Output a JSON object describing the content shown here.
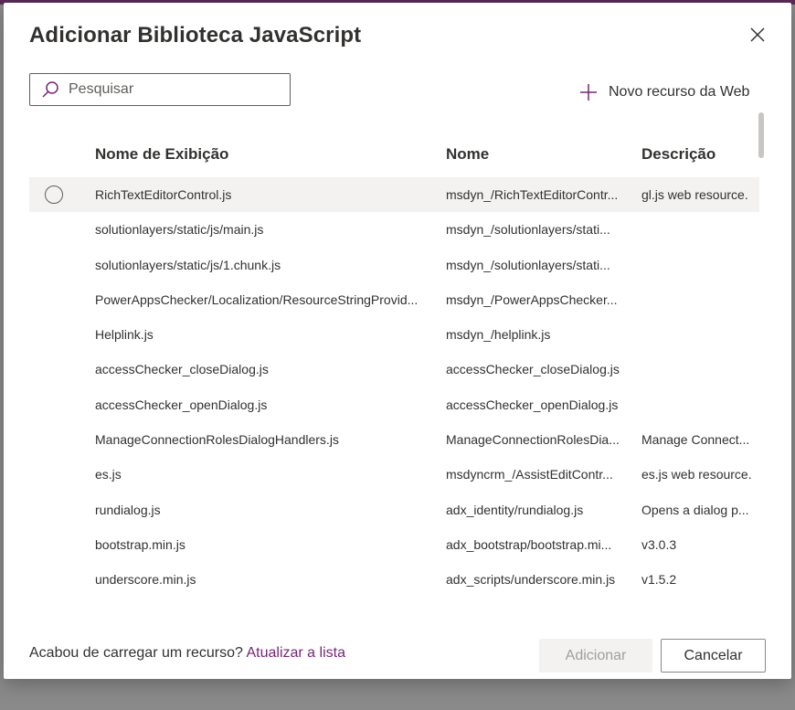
{
  "dialog": {
    "title": "Adicionar Biblioteca JavaScript",
    "close_icon": "close-icon"
  },
  "search": {
    "placeholder": "Pesquisar",
    "value": "",
    "icon": "search-icon"
  },
  "toolbar": {
    "new_resource_label": "Novo recurso da Web",
    "new_resource_icon": "plus-icon"
  },
  "table": {
    "headers": [
      "Nome de Exibição",
      "Nome",
      "Descrição"
    ],
    "rows": [
      {
        "display": "RichTextEditorControl.js",
        "name": "msdyn_/RichTextEditorContr...",
        "desc": "gl.js web resource."
      },
      {
        "display": "solutionlayers/static/js/main.js",
        "name": "msdyn_/solutionlayers/stati...",
        "desc": ""
      },
      {
        "display": "solutionlayers/static/js/1.chunk.js",
        "name": "msdyn_/solutionlayers/stati...",
        "desc": ""
      },
      {
        "display": "PowerAppsChecker/Localization/ResourceStringProvid...",
        "name": "msdyn_/PowerAppsChecker...",
        "desc": ""
      },
      {
        "display": "Helplink.js",
        "name": "msdyn_/helplink.js",
        "desc": ""
      },
      {
        "display": "accessChecker_closeDialog.js",
        "name": "accessChecker_closeDialog.js",
        "desc": ""
      },
      {
        "display": "accessChecker_openDialog.js",
        "name": "accessChecker_openDialog.js",
        "desc": ""
      },
      {
        "display": "ManageConnectionRolesDialogHandlers.js",
        "name": "ManageConnectionRolesDia...",
        "desc": "Manage Connect..."
      },
      {
        "display": "es.js",
        "name": "msdyncrm_/AssistEditContr...",
        "desc": "es.js web resource."
      },
      {
        "display": "rundialog.js",
        "name": "adx_identity/rundialog.js",
        "desc": "Opens a dialog p..."
      },
      {
        "display": "bootstrap.min.js",
        "name": "adx_bootstrap/bootstrap.mi...",
        "desc": "v3.0.3"
      },
      {
        "display": "underscore.min.js",
        "name": "adx_scripts/underscore.min.js",
        "desc": "v1.5.2"
      }
    ]
  },
  "footer": {
    "prompt": "Acabou de carregar um recurso?",
    "refresh_link": "Atualizar a lista",
    "add_label": "Adicionar",
    "cancel_label": "Cancelar"
  },
  "colors": {
    "accent": "#742774",
    "disabled_bg": "#f3f2f1",
    "selected_row": "#f3f2f1"
  }
}
